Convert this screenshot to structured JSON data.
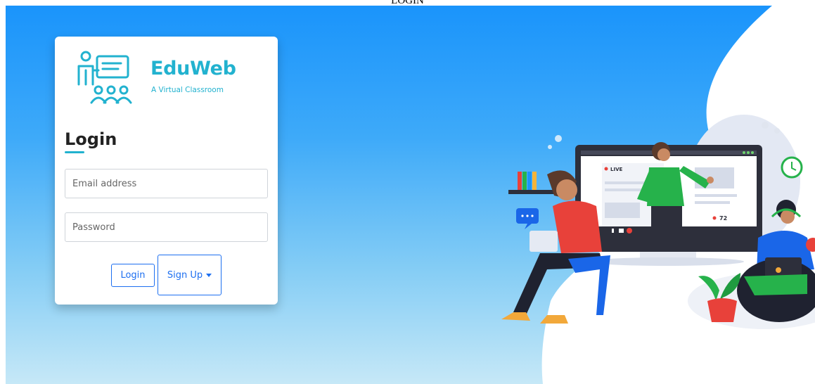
{
  "page": {
    "title": "LOGIN"
  },
  "brand": {
    "name": "EduWeb",
    "tagline": "A Virtual Classroom"
  },
  "form": {
    "heading": "Login",
    "email_placeholder": "Email address",
    "password_placeholder": "Password",
    "login_label": "Login",
    "signup_label": "Sign Up"
  },
  "illustration": {
    "screen_live_label": "LIVE",
    "viewer_count": "72",
    "chat_bubble": "•••"
  },
  "colors": {
    "brand": "#22b2cf",
    "primary_button": "#1d6ff0",
    "hero_top": "#1a94fb",
    "hero_bottom": "#c6e8f7"
  }
}
